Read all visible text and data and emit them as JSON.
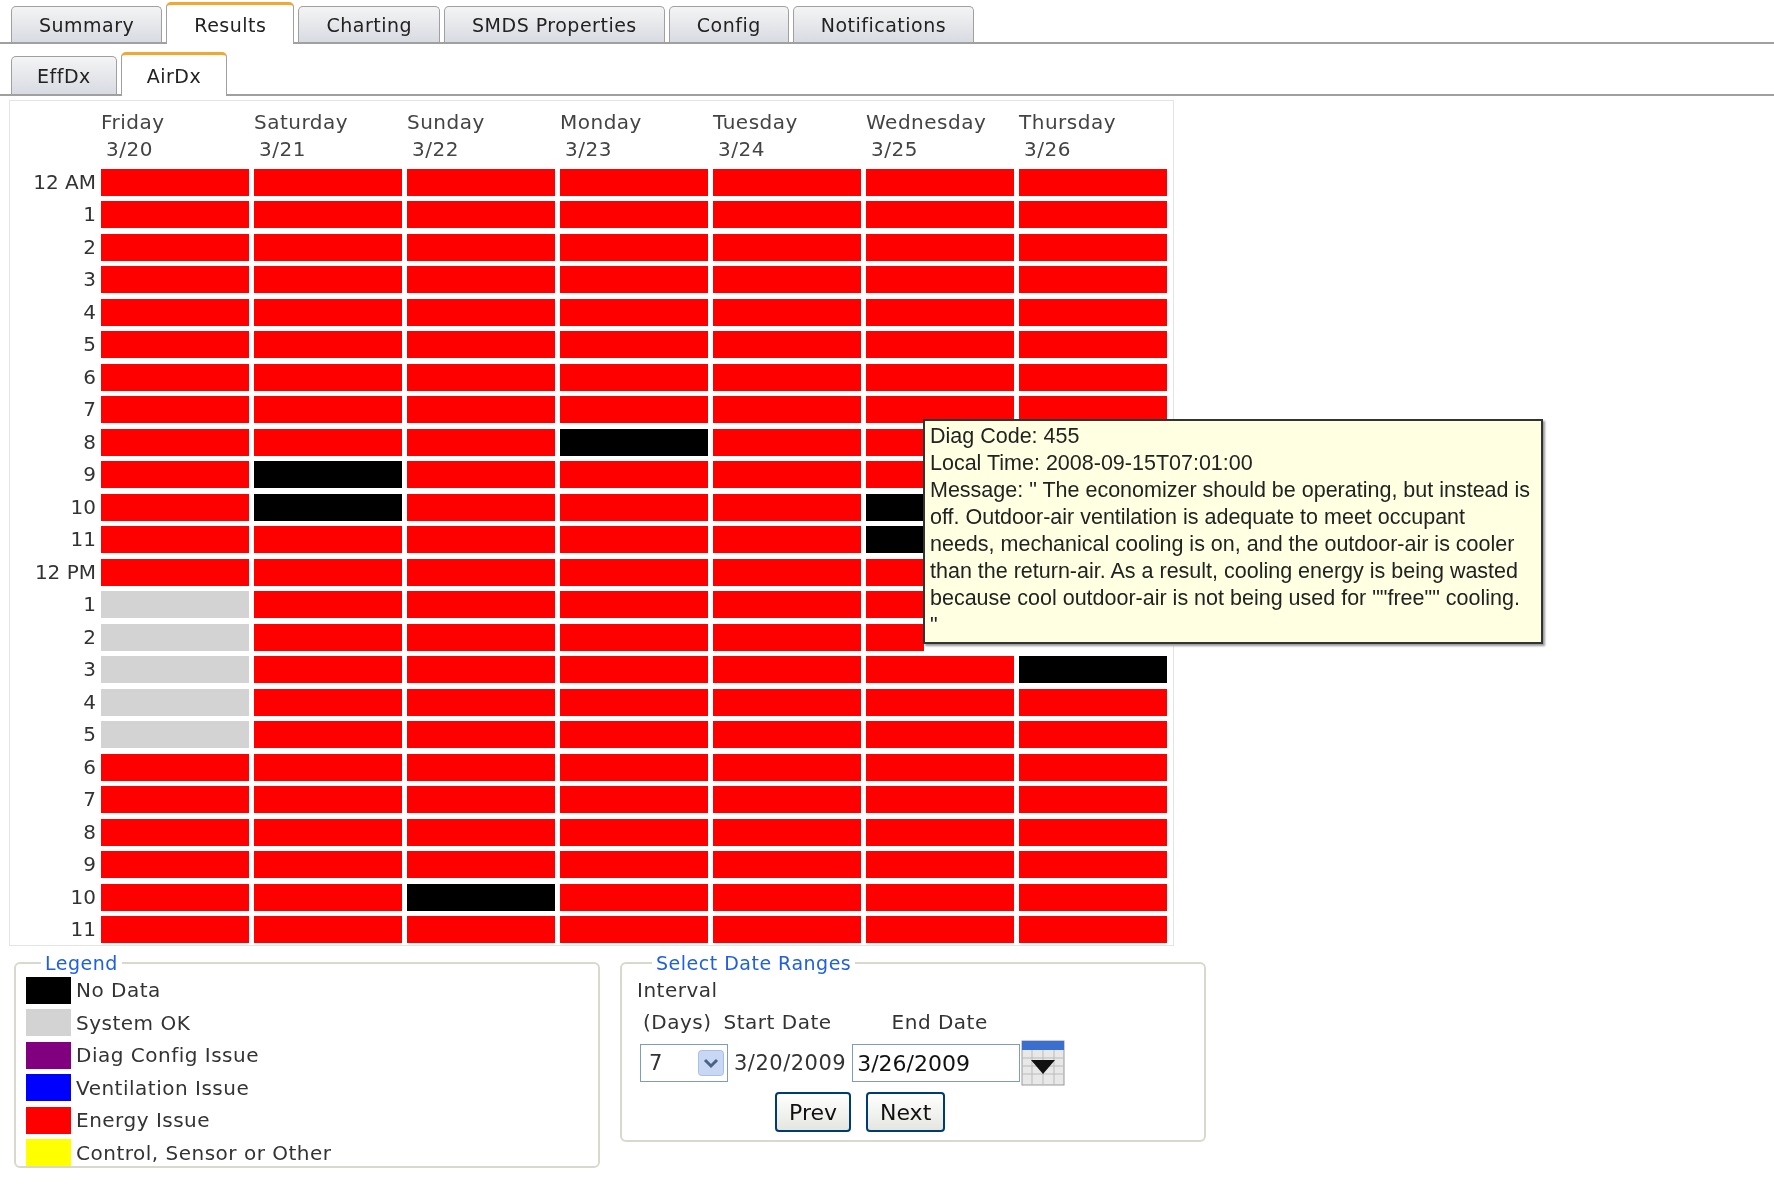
{
  "tabs": [
    {
      "label": "Summary",
      "selected": false
    },
    {
      "label": "Results",
      "selected": true
    },
    {
      "label": "Charting",
      "selected": false
    },
    {
      "label": "SMDS Properties",
      "selected": false
    },
    {
      "label": "Config",
      "selected": false
    },
    {
      "label": "Notifications",
      "selected": false
    }
  ],
  "subtabs": [
    {
      "label": "EffDx",
      "selected": false
    },
    {
      "label": "AirDx",
      "selected": true
    }
  ],
  "grid": {
    "days": [
      {
        "name": "Friday",
        "date": "3/20"
      },
      {
        "name": "Saturday",
        "date": "3/21"
      },
      {
        "name": "Sunday",
        "date": "3/22"
      },
      {
        "name": "Monday",
        "date": "3/23"
      },
      {
        "name": "Tuesday",
        "date": "3/24"
      },
      {
        "name": "Wednesday",
        "date": "3/25"
      },
      {
        "name": "Thursday",
        "date": "3/26"
      }
    ],
    "rows": [
      {
        "hour": "12 AM",
        "cells": [
          {
            "color": "#ff0000"
          },
          {
            "color": "#ff0000"
          },
          {
            "color": "#ff0000"
          },
          {
            "color": "#ff0000"
          },
          {
            "color": "#ff0000"
          },
          {
            "color": "#ff0000"
          },
          {
            "color": "#ff0000"
          }
        ]
      },
      {
        "hour": "1",
        "cells": [
          {
            "color": "#ff0000"
          },
          {
            "color": "#ff0000"
          },
          {
            "color": "#ff0000"
          },
          {
            "color": "#ff0000"
          },
          {
            "color": "#ff0000"
          },
          {
            "color": "#ff0000"
          },
          {
            "color": "#ff0000"
          }
        ]
      },
      {
        "hour": "2",
        "cells": [
          {
            "color": "#ff0000"
          },
          {
            "color": "#ff0000"
          },
          {
            "color": "#ff0000"
          },
          {
            "color": "#ff0000"
          },
          {
            "color": "#ff0000"
          },
          {
            "color": "#ff0000"
          },
          {
            "color": "#ff0000"
          }
        ]
      },
      {
        "hour": "3",
        "cells": [
          {
            "color": "#ff0000"
          },
          {
            "color": "#ff0000"
          },
          {
            "color": "#ff0000"
          },
          {
            "color": "#ff0000"
          },
          {
            "color": "#ff0000"
          },
          {
            "color": "#ff0000"
          },
          {
            "color": "#ff0000"
          }
        ]
      },
      {
        "hour": "4",
        "cells": [
          {
            "color": "#ff0000"
          },
          {
            "color": "#ff0000"
          },
          {
            "color": "#ff0000"
          },
          {
            "color": "#ff0000"
          },
          {
            "color": "#ff0000"
          },
          {
            "color": "#ff0000"
          },
          {
            "color": "#ff0000"
          }
        ]
      },
      {
        "hour": "5",
        "cells": [
          {
            "color": "#ff0000"
          },
          {
            "color": "#ff0000"
          },
          {
            "color": "#ff0000"
          },
          {
            "color": "#ff0000"
          },
          {
            "color": "#ff0000"
          },
          {
            "color": "#ff0000"
          },
          {
            "color": "#ff0000"
          }
        ]
      },
      {
        "hour": "6",
        "cells": [
          {
            "color": "#ff0000"
          },
          {
            "color": "#ff0000"
          },
          {
            "color": "#ff0000"
          },
          {
            "color": "#ff0000"
          },
          {
            "color": "#ff0000"
          },
          {
            "color": "#ff0000"
          },
          {
            "color": "#ff0000"
          }
        ]
      },
      {
        "hour": "7",
        "cells": [
          {
            "color": "#ff0000"
          },
          {
            "color": "#ff0000"
          },
          {
            "color": "#ff0000"
          },
          {
            "color": "#ff0000"
          },
          {
            "color": "#ff0000"
          },
          {
            "color": "#ff0000"
          },
          {
            "color": "#ff0000"
          }
        ]
      },
      {
        "hour": "8",
        "cells": [
          {
            "color": "#ff0000"
          },
          {
            "color": "#ff0000"
          },
          {
            "color": "#ff0000"
          },
          {
            "color": "#000000"
          },
          {
            "color": "#ff0000"
          },
          {
            "color": "#ff0000"
          },
          null
        ]
      },
      {
        "hour": "9",
        "cells": [
          {
            "color": "#ff0000"
          },
          {
            "color": "#000000"
          },
          {
            "color": "#ff0000"
          },
          {
            "color": "#ff0000"
          },
          {
            "color": "#ff0000"
          },
          {
            "color": "#ff0000"
          },
          null
        ]
      },
      {
        "hour": "10",
        "cells": [
          {
            "color": "#ff0000"
          },
          {
            "color": "#000000"
          },
          {
            "color": "#ff0000"
          },
          {
            "color": "#ff0000"
          },
          {
            "color": "#ff0000"
          },
          {
            "color": "#000000"
          },
          null
        ]
      },
      {
        "hour": "11",
        "cells": [
          {
            "color": "#ff0000"
          },
          {
            "color": "#ff0000"
          },
          {
            "color": "#ff0000"
          },
          {
            "color": "#ff0000"
          },
          {
            "color": "#ff0000"
          },
          {
            "color": "#000000"
          },
          null
        ]
      },
      {
        "hour": "12 PM",
        "cells": [
          {
            "color": "#ff0000"
          },
          {
            "color": "#ff0000"
          },
          {
            "color": "#ff0000"
          },
          {
            "color": "#ff0000"
          },
          {
            "color": "#ff0000"
          },
          {
            "color": "#ff0000"
          },
          null
        ]
      },
      {
        "hour": "1",
        "cells": [
          {
            "color": "#d3d3d3"
          },
          {
            "color": "#ff0000"
          },
          {
            "color": "#ff0000"
          },
          {
            "color": "#ff0000"
          },
          {
            "color": "#ff0000"
          },
          {
            "color": "#ff0000"
          },
          null
        ]
      },
      {
        "hour": "2",
        "cells": [
          {
            "color": "#d3d3d3"
          },
          {
            "color": "#ff0000"
          },
          {
            "color": "#ff0000"
          },
          {
            "color": "#ff0000"
          },
          {
            "color": "#ff0000"
          },
          {
            "color": "#ff0000"
          },
          null
        ]
      },
      {
        "hour": "3",
        "cells": [
          {
            "color": "#d3d3d3"
          },
          {
            "color": "#ff0000"
          },
          {
            "color": "#ff0000"
          },
          {
            "color": "#ff0000"
          },
          {
            "color": "#ff0000"
          },
          {
            "color": "#ff0000"
          },
          {
            "color": "#000000"
          }
        ]
      },
      {
        "hour": "4",
        "cells": [
          {
            "color": "#d3d3d3"
          },
          {
            "color": "#ff0000"
          },
          {
            "color": "#ff0000"
          },
          {
            "color": "#ff0000"
          },
          {
            "color": "#ff0000"
          },
          {
            "color": "#ff0000"
          },
          {
            "color": "#ff0000"
          }
        ]
      },
      {
        "hour": "5",
        "cells": [
          {
            "color": "#d3d3d3"
          },
          {
            "color": "#ff0000"
          },
          {
            "color": "#ff0000"
          },
          {
            "color": "#ff0000"
          },
          {
            "color": "#ff0000"
          },
          {
            "color": "#ff0000"
          },
          {
            "color": "#ff0000"
          }
        ]
      },
      {
        "hour": "6",
        "cells": [
          {
            "color": "#ff0000"
          },
          {
            "color": "#ff0000"
          },
          {
            "color": "#ff0000"
          },
          {
            "color": "#ff0000"
          },
          {
            "color": "#ff0000"
          },
          {
            "color": "#ff0000"
          },
          {
            "color": "#ff0000"
          }
        ]
      },
      {
        "hour": "7",
        "cells": [
          {
            "color": "#ff0000"
          },
          {
            "color": "#ff0000"
          },
          {
            "color": "#ff0000"
          },
          {
            "color": "#ff0000"
          },
          {
            "color": "#ff0000"
          },
          {
            "color": "#ff0000"
          },
          {
            "color": "#ff0000"
          }
        ]
      },
      {
        "hour": "8",
        "cells": [
          {
            "color": "#ff0000"
          },
          {
            "color": "#ff0000"
          },
          {
            "color": "#ff0000"
          },
          {
            "color": "#ff0000"
          },
          {
            "color": "#ff0000"
          },
          {
            "color": "#ff0000"
          },
          {
            "color": "#ff0000"
          }
        ]
      },
      {
        "hour": "9",
        "cells": [
          {
            "color": "#ff0000"
          },
          {
            "color": "#ff0000"
          },
          {
            "color": "#ff0000"
          },
          {
            "color": "#ff0000"
          },
          {
            "color": "#ff0000"
          },
          {
            "color": "#ff0000"
          },
          {
            "color": "#ff0000"
          }
        ]
      },
      {
        "hour": "10",
        "cells": [
          {
            "color": "#ff0000"
          },
          {
            "color": "#ff0000"
          },
          {
            "color": "#000000"
          },
          {
            "color": "#ff0000"
          },
          {
            "color": "#ff0000"
          },
          {
            "color": "#ff0000"
          },
          {
            "color": "#ff0000"
          }
        ]
      },
      {
        "hour": "11",
        "cells": [
          {
            "color": "#ff0000"
          },
          {
            "color": "#ff0000"
          },
          {
            "color": "#ff0000"
          },
          {
            "color": "#ff0000"
          },
          {
            "color": "#ff0000"
          },
          {
            "color": "#ff0000"
          },
          {
            "color": "#ff0000"
          }
        ]
      }
    ]
  },
  "tooltip": {
    "diag_code": "Diag Code: 455",
    "local_time": "Local Time: 2008-09-15T07:01:00",
    "message": "Message: \" The economizer should be operating, but instead is off.  Outdoor-air ventilation is adequate to meet occupant needs, mechanical cooling is on, and the outdoor-air is cooler than the return-air.  As a result, cooling energy is being wasted because cool outdoor-air is not being used for \"\"free\"\" cooling. \""
  },
  "legend": {
    "title": "Legend",
    "items": [
      {
        "label": "No Data",
        "color": "#000000"
      },
      {
        "label": "System OK",
        "color": "#d3d3d3"
      },
      {
        "label": "Diag Config Issue",
        "color": "#800080"
      },
      {
        "label": "Ventilation Issue",
        "color": "#0000ff"
      },
      {
        "label": "Energy Issue",
        "color": "#ff0000"
      },
      {
        "label": "Control, Sensor or Other",
        "color": "#ffff00"
      }
    ]
  },
  "date_ranges": {
    "title": "Select Date Ranges",
    "interval_label": "Interval",
    "days_label": "(Days)",
    "start_label": "Start Date",
    "end_label": "End Date",
    "interval": "7",
    "start_date": "3/20/2009",
    "end_date": "3/26/2009",
    "buttons": [
      "Prev",
      "Next"
    ]
  }
}
